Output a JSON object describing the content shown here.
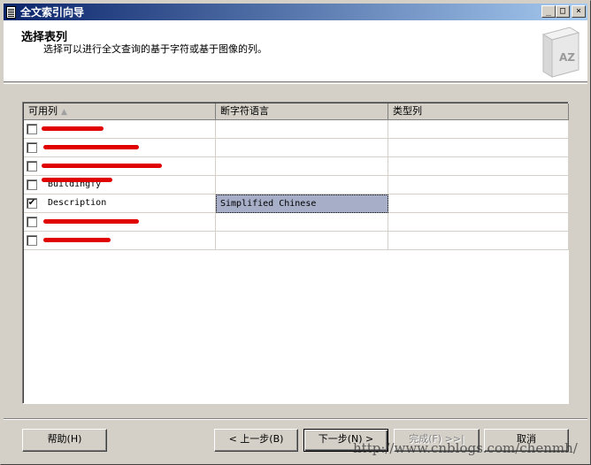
{
  "window": {
    "title": "全文索引向导",
    "controls": {
      "minimize": "_",
      "maximize": "□",
      "close": "×"
    }
  },
  "header": {
    "title": "选择表列",
    "subtitle": "选择可以进行全文查询的基于字符或基于图像的列。",
    "image_text": "AZ"
  },
  "grid": {
    "columns": [
      "可用列",
      "断字符语言",
      "类型列"
    ],
    "sort_glyph": "▲",
    "rows": [
      {
        "checked": false,
        "name": "",
        "language": "",
        "type": "",
        "redacted": true
      },
      {
        "checked": false,
        "name": "",
        "language": "",
        "type": "",
        "redacted": true
      },
      {
        "checked": false,
        "name": "",
        "language": "",
        "type": "",
        "redacted": true
      },
      {
        "checked": false,
        "name": "Buildingfy",
        "language": "",
        "type": "",
        "redacted": true
      },
      {
        "checked": true,
        "name": "Description",
        "language": "Simplified Chinese",
        "type": "",
        "redacted": false
      },
      {
        "checked": false,
        "name": "",
        "language": "",
        "type": "",
        "redacted": true
      },
      {
        "checked": false,
        "name": "",
        "language": "",
        "type": "",
        "redacted": true
      }
    ]
  },
  "buttons": {
    "help": "帮助(H)",
    "back": "< 上一步(B)",
    "next": "下一步(N) >",
    "finish": "完成(F) >>|",
    "cancel": "取消"
  },
  "watermark": "http://www.cnblogs.com/chenmh/"
}
